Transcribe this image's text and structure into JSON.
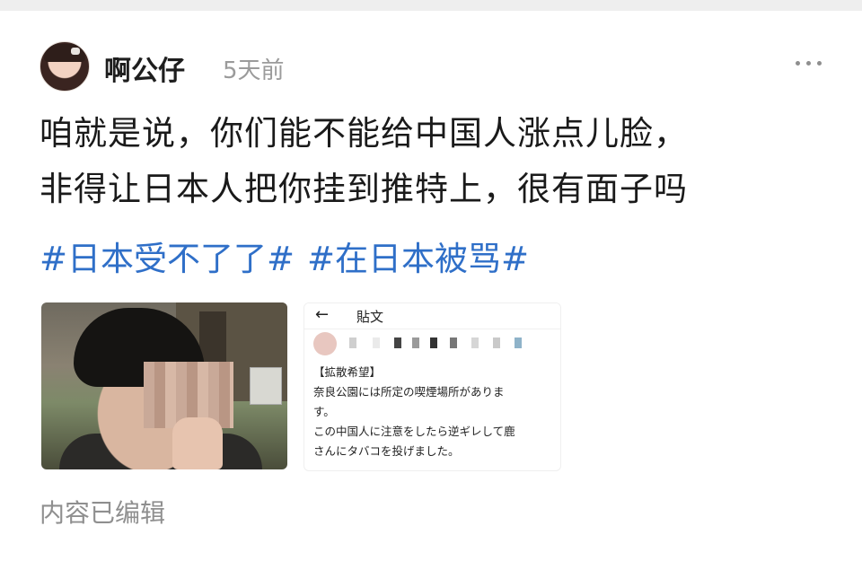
{
  "post": {
    "author": "啊公仔",
    "time": "5天前",
    "text_lines": [
      "咱就是说，你们能不能给中国人涨点儿脸，",
      "非得让日本人把你挂到推特上，很有面子吗"
    ],
    "hashtags": [
      "#日本受不了了#",
      "#在日本被骂#"
    ],
    "edited_note": "内容已编辑"
  },
  "screenshot_image": {
    "header_title": "貼文",
    "lines": [
      "【拡散希望】",
      "奈良公園には所定の喫煙場所がありま",
      "す。",
      "この中国人に注意をしたら逆ギレして鹿",
      "さんにタバコを投げました。"
    ]
  },
  "icons": {
    "more": "more-horizontal-icon",
    "back": "arrow-left-icon"
  },
  "colors": {
    "hashtag": "#2f6fc8",
    "meta_text": "#9b9b9b"
  }
}
